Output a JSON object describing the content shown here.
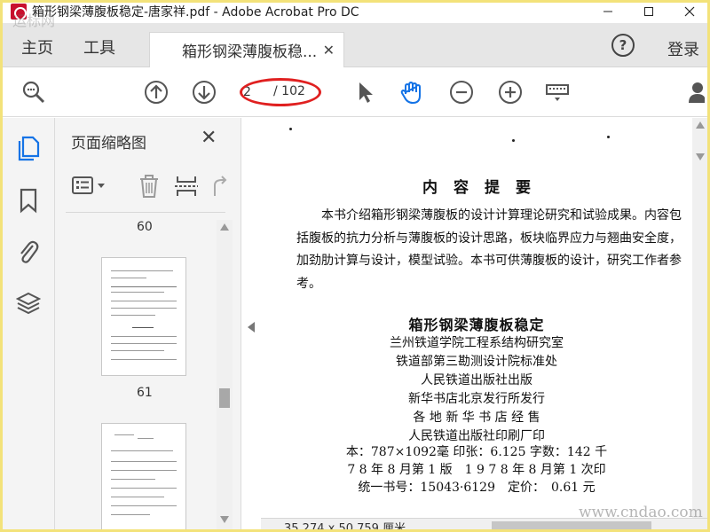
{
  "window": {
    "title": "箱形钢梁薄腹板稳定-唐家祥.pdf - Adobe Acrobat Pro DC",
    "watermark_top": "运标网",
    "watermark_bottom": "www.cndao.com"
  },
  "menu": {
    "home": "主页",
    "tools": "工具",
    "doc_tab": "箱形钢梁薄腹板稳...",
    "login": "登录"
  },
  "toolbar": {
    "current_page": "2",
    "total_pages": "/ 102"
  },
  "thumbnails_panel": {
    "title": "页面缩略图",
    "pages": [
      "60",
      "61"
    ]
  },
  "document": {
    "heading": "内容提要",
    "summary": "本书介绍箱形钢梁薄腹板的设计计算理论研究和试验成果。内容包括腹板的抗力分析与薄腹板的设计思路，板块临界应力与翘曲安全度，加劲肋计算与设计，模型试验。本书可供薄腹板的设计，研究工作者参考。",
    "book_title": "箱形钢梁薄腹板稳定",
    "publication_lines": [
      "兰州铁道学院工程系结构研究室",
      "铁道部第三勘测设计院标准处",
      "人民铁道出版社出版",
      "新华书店北京发行所发行",
      "各 地 新 华 书 店 经 售",
      "人民铁道出版社印刷厂印",
      "本：787×1092毫 印张：6.125 字数：142 千",
      "7 8 年 8 月第 1 版　1 9 7 8 年 8 月第 1 次印",
      "统一书号：15043·6129　定价：　0.61 元"
    ]
  },
  "status": {
    "dimensions": "35.274 x 50.759 厘米"
  },
  "colors": {
    "accent_blue": "#1473e6",
    "annotation_red": "#e02020",
    "panel_bg": "#f4f4f4"
  }
}
